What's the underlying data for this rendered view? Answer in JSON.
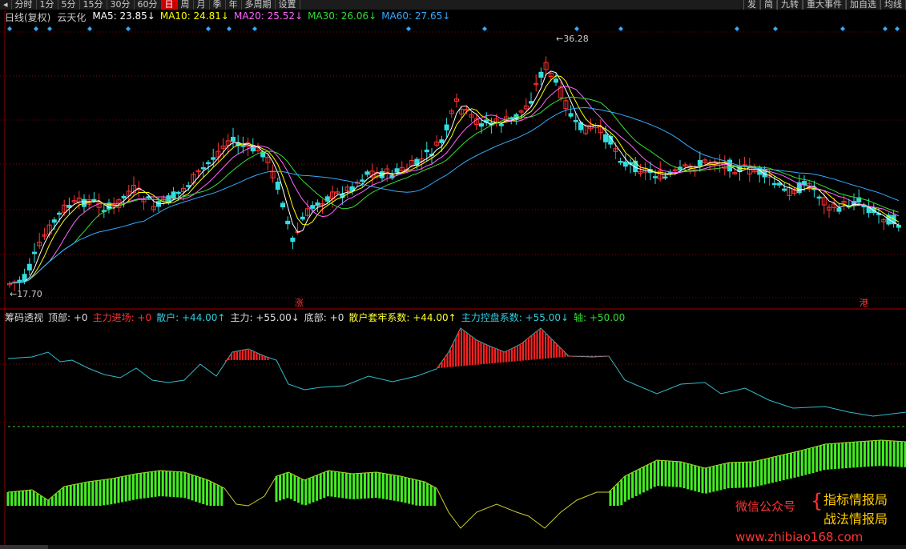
{
  "toolbar": {
    "back_icon": "back-arrow-icon",
    "periods": [
      "分时",
      "1分",
      "5分",
      "15分",
      "30分",
      "60分",
      "日",
      "周",
      "月",
      "季",
      "年",
      "多周期",
      "设置"
    ],
    "active_period": "日",
    "right_buttons": [
      "发",
      "简",
      "九转",
      "重大事件",
      "加自选",
      "均线"
    ]
  },
  "main_chart": {
    "title": "日线(复权)",
    "stock_name": "云天化",
    "ma": [
      {
        "label": "MA5: 23.85↓",
        "color": "#ffffff"
      },
      {
        "label": "MA10: 24.81↓",
        "color": "#ffff00"
      },
      {
        "label": "MA20: 25.52↓",
        "color": "#ff66ff"
      },
      {
        "label": "MA30: 26.06↓",
        "color": "#33dd33"
      },
      {
        "label": "MA60: 27.65↓",
        "color": "#33aaff"
      }
    ],
    "high_label": "36.28",
    "low_label": "17.70",
    "marker_zhang": "涨",
    "marker_gang": "港"
  },
  "indicator": {
    "name": "筹码透视",
    "items": [
      {
        "label": "顶部: +0",
        "color": "#dddddd"
      },
      {
        "label": "主力进场: +0",
        "color": "#ff3333"
      },
      {
        "label": "散户: +44.00↑",
        "color": "#33ccdd"
      },
      {
        "label": "主力: +55.00↓",
        "color": "#dddddd"
      },
      {
        "label": "底部: +0",
        "color": "#dddddd"
      },
      {
        "label": "散户套牢系数: +44.00↑",
        "color": "#ffff33"
      },
      {
        "label": "主力控盘系数: +55.00↓",
        "color": "#33ccdd"
      },
      {
        "label": "轴: +50.00",
        "color": "#33dd33"
      }
    ]
  },
  "watermark": {
    "line1": "指标情报局",
    "line2": "战法情报局",
    "left": "微信公众号",
    "url": "www.zhibiao168.com"
  },
  "colors": {
    "up": "#ff3333",
    "down": "#33dddd",
    "grid": "#8b0000"
  }
}
